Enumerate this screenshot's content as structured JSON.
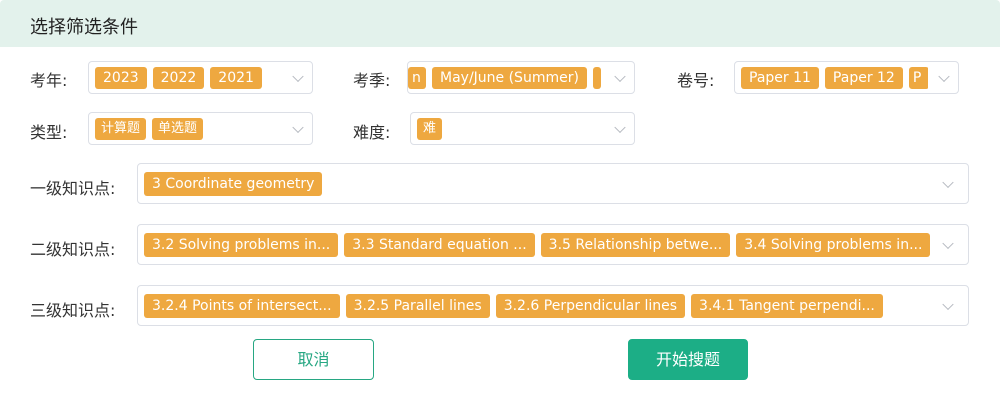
{
  "header": {
    "title": "选择筛选条件"
  },
  "filters": {
    "year": {
      "label": "考年:",
      "tags": [
        "2023",
        "2022",
        "2021"
      ]
    },
    "season": {
      "label": "考季:",
      "tags": [
        "n",
        "May/June (Summer)",
        ""
      ]
    },
    "paper": {
      "label": "卷号:",
      "tags": [
        "Paper 11",
        "Paper 12",
        "P"
      ]
    },
    "type": {
      "label": "类型:",
      "tags": [
        "计算题",
        "单选题"
      ]
    },
    "difficulty": {
      "label": "难度:",
      "tags": [
        "难"
      ]
    },
    "level1": {
      "label": "一级知识点:",
      "tags": [
        "3 Coordinate geometry"
      ]
    },
    "level2": {
      "label": "二级知识点:",
      "tags": [
        "3.2 Solving problems in...",
        "3.3 Standard equation ...",
        "3.5 Relationship betwe...",
        "3.4 Solving problems in..."
      ]
    },
    "level3": {
      "label": "三级知识点:",
      "tags": [
        "3.2.4 Points of intersect...",
        "3.2.5 Parallel lines",
        "3.2.6 Perpendicular lines",
        "3.4.1 Tangent perpendi..."
      ]
    }
  },
  "actions": {
    "cancel_label": "取消",
    "search_label": "开始搜题"
  },
  "colors": {
    "header_bg": "#e3f2ec",
    "tag_bg": "#eea840",
    "primary": "#1cae86"
  },
  "icons": {
    "dropdown": "chevron-down-icon"
  }
}
